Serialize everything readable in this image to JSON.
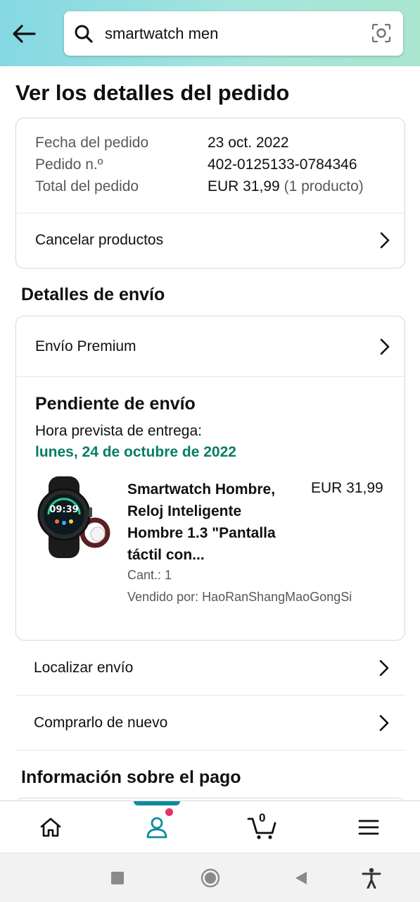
{
  "search": {
    "value": "smartwatch men"
  },
  "page": {
    "title": "Ver los detalles del pedido"
  },
  "order": {
    "date_label": "Fecha del pedido",
    "date_value": "23 oct. 2022",
    "number_label": "Pedido n.º",
    "number_value": "402-0125133-0784346",
    "total_label": "Total del pedido",
    "total_value": "EUR 31,99",
    "total_count": "(1 producto)",
    "cancel_label": "Cancelar productos"
  },
  "shipping": {
    "section_title": "Detalles de envío",
    "method": "Envío Premium",
    "status": "Pendiente de envío",
    "eta_label": "Hora prevista de entrega:",
    "eta_date": "lunes, 24 de octubre de 2022",
    "product": {
      "title": "Smartwatch Hombre, Reloj Inteligente Hombre 1.3 \"Pantalla táctil con...",
      "price": "EUR 31,99",
      "quantity": "Cant.: 1",
      "seller": "Vendido por: HaoRanShangMaoGongSi",
      "image_time": "09:39"
    }
  },
  "actions": {
    "track": "Localizar envío",
    "buy_again": "Comprarlo de nuevo"
  },
  "payment": {
    "section_title": "Información sobre el pago"
  },
  "nav": {
    "items": [
      "home-icon",
      "account-icon",
      "cart-icon",
      "menu-icon"
    ],
    "cart_count": "0",
    "active": "account"
  },
  "colors": {
    "header_start": "#84d8e3",
    "header_end": "#a8e6cf",
    "eta_green": "#067d62",
    "nav_indicator": "#0f8a9c",
    "notification": "#e3316b"
  }
}
